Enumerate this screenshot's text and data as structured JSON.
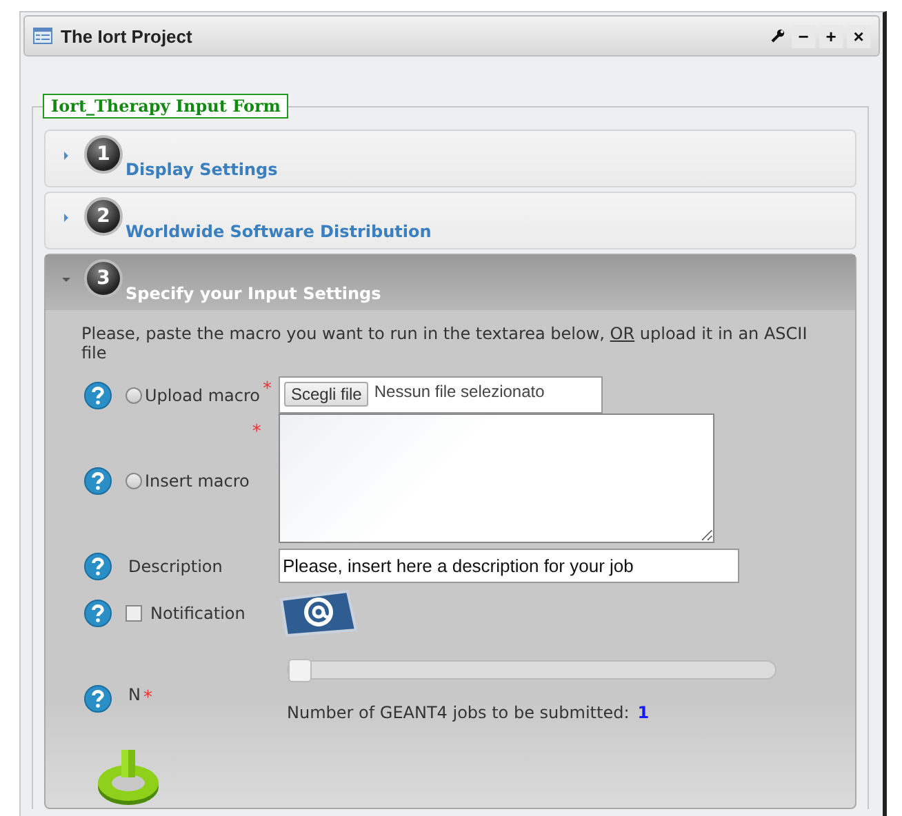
{
  "window": {
    "title": "The Iort Project",
    "controls": [
      "−",
      "+",
      "×"
    ]
  },
  "form": {
    "legend": "Iort_Therapy Input Form"
  },
  "sections": [
    {
      "number": "1",
      "title": "Display Settings",
      "expanded": false
    },
    {
      "number": "2",
      "title": "Worldwide Software Distribution",
      "expanded": false
    },
    {
      "number": "3",
      "title": "Specify your Input Settings",
      "expanded": true
    }
  ],
  "intro": {
    "before": "Please, paste the macro you want to run in the textarea below,",
    "link": "OR",
    "after": "upload it in an ASCII file"
  },
  "fields": [
    {
      "kind": "upload",
      "label": "Upload macro",
      "required_mark": "*",
      "selected": false,
      "button": "Scegli file",
      "status": "Nessun file selezionato"
    },
    {
      "kind": "textarea",
      "label": "Insert macro",
      "required_mark": "*",
      "selected": false
    },
    {
      "kind": "text",
      "label": "Description",
      "value": "Please, insert here a description for your job"
    },
    {
      "kind": "checkbox",
      "label": "Notification",
      "checked": false
    },
    {
      "kind": "slider",
      "label": "N",
      "required_mark": "*",
      "level": 0,
      "caption": "Number of GEANT4 jobs to be submitted:",
      "reading": "1"
    }
  ]
}
